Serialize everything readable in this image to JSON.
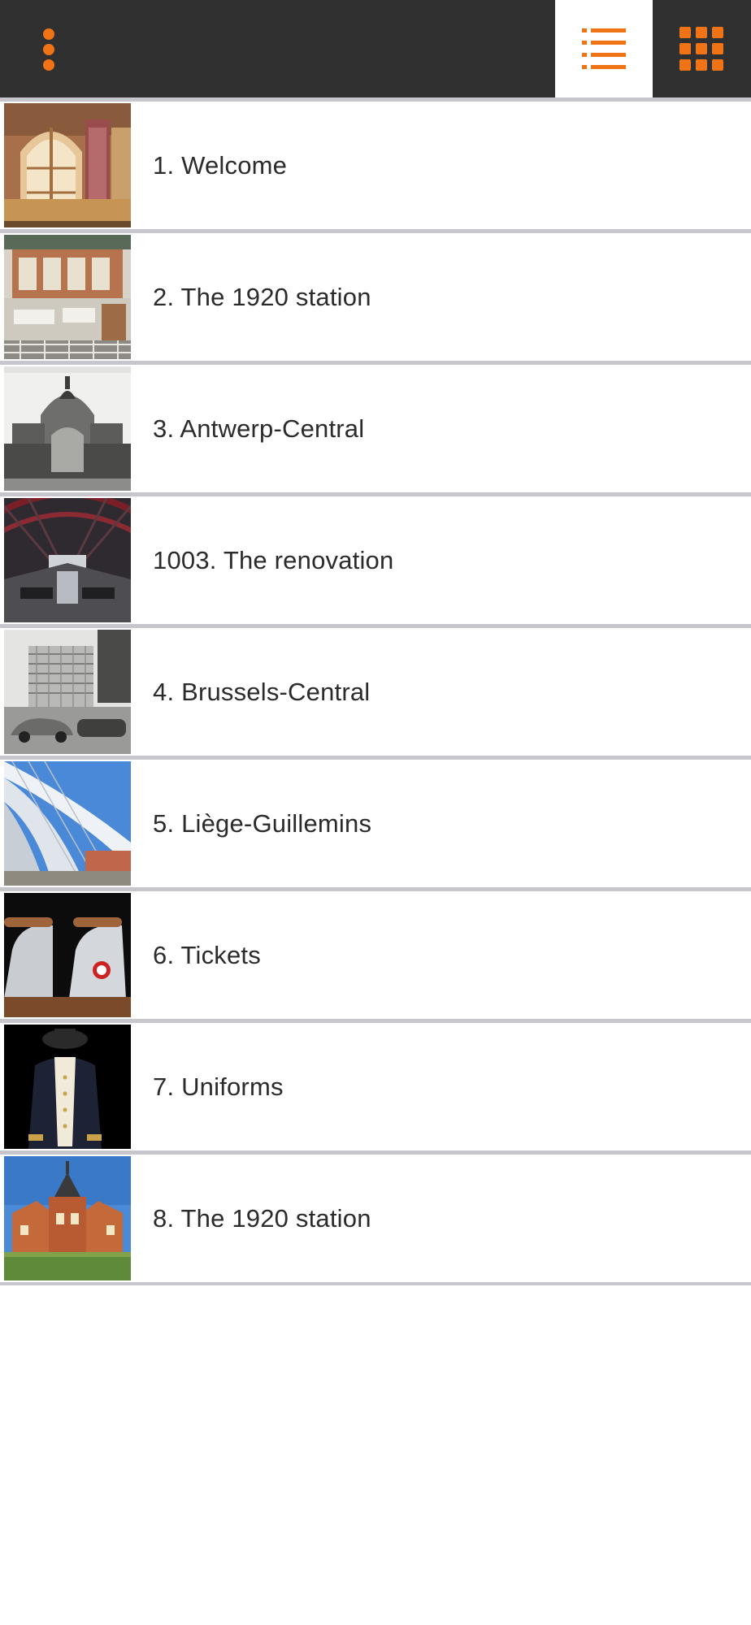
{
  "toolbar": {
    "menu_icon": "vertical-dots-icon",
    "list_view_icon": "list-icon",
    "grid_view_icon": "grid-icon",
    "accent": "#f07316",
    "bar_color": "#303030"
  },
  "items": [
    {
      "label": "1. Welcome",
      "thumb": "welcome-hall-photo"
    },
    {
      "label": "2. The 1920 station",
      "thumb": "ticket-hall-photo"
    },
    {
      "label": "3. Antwerp-Central",
      "thumb": "antwerp-central-postcard"
    },
    {
      "label": "1003. The renovation",
      "thumb": "train-shed-photo"
    },
    {
      "label": "4. Brussels-Central",
      "thumb": "brussels-central-photo"
    },
    {
      "label": "5. Liège-Guillemins",
      "thumb": "liege-guillemins-photo"
    },
    {
      "label": "6. Tickets",
      "thumb": "ticket-machine-photo"
    },
    {
      "label": "7. Uniforms",
      "thumb": "uniform-photo"
    },
    {
      "label": "8. The 1920 station",
      "thumb": "brick-station-photo"
    }
  ]
}
